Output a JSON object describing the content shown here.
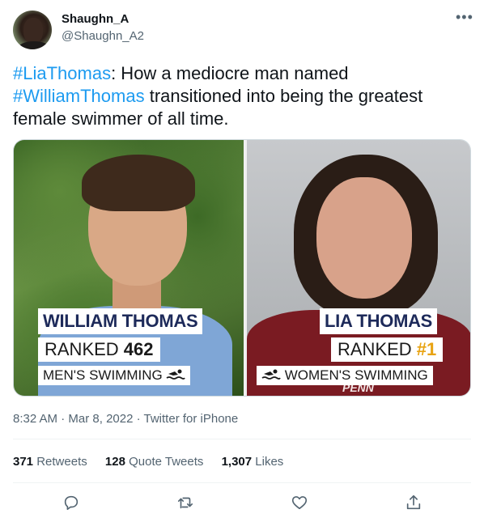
{
  "author": {
    "display_name": "Shaughn_A",
    "handle": "@Shaughn_A2"
  },
  "tweet": {
    "hashtag_1": "#LiaThomas",
    "text_1": ": How a mediocre man named ",
    "hashtag_2": "#WilliamThomas",
    "text_2": " transitioned into being the greatest female swimmer of all time."
  },
  "media": {
    "left": {
      "name": "WILLIAM THOMAS",
      "rank_prefix": "RANKED ",
      "rank_value": "462",
      "category": "MEN'S SWIMMING"
    },
    "right": {
      "name": "LIA THOMAS",
      "rank_prefix": "RANKED ",
      "rank_value": "#1",
      "category": "WOMEN'S SWIMMING",
      "shirt_text": "PENN"
    }
  },
  "meta": {
    "time": "8:32 AM",
    "date": "Mar 8, 2022",
    "source": "Twitter for iPhone"
  },
  "stats": {
    "retweets_count": "371",
    "retweets_label": "Retweets",
    "quotes_count": "128",
    "quotes_label": "Quote Tweets",
    "likes_count": "1,307",
    "likes_label": "Likes"
  },
  "colors": {
    "link": "#1d9bf0",
    "secondary_text": "#536471",
    "divider": "#eff3f4"
  },
  "icons": [
    "more-icon",
    "reply-icon",
    "retweet-icon",
    "like-icon",
    "share-icon",
    "swimmer-icon"
  ]
}
